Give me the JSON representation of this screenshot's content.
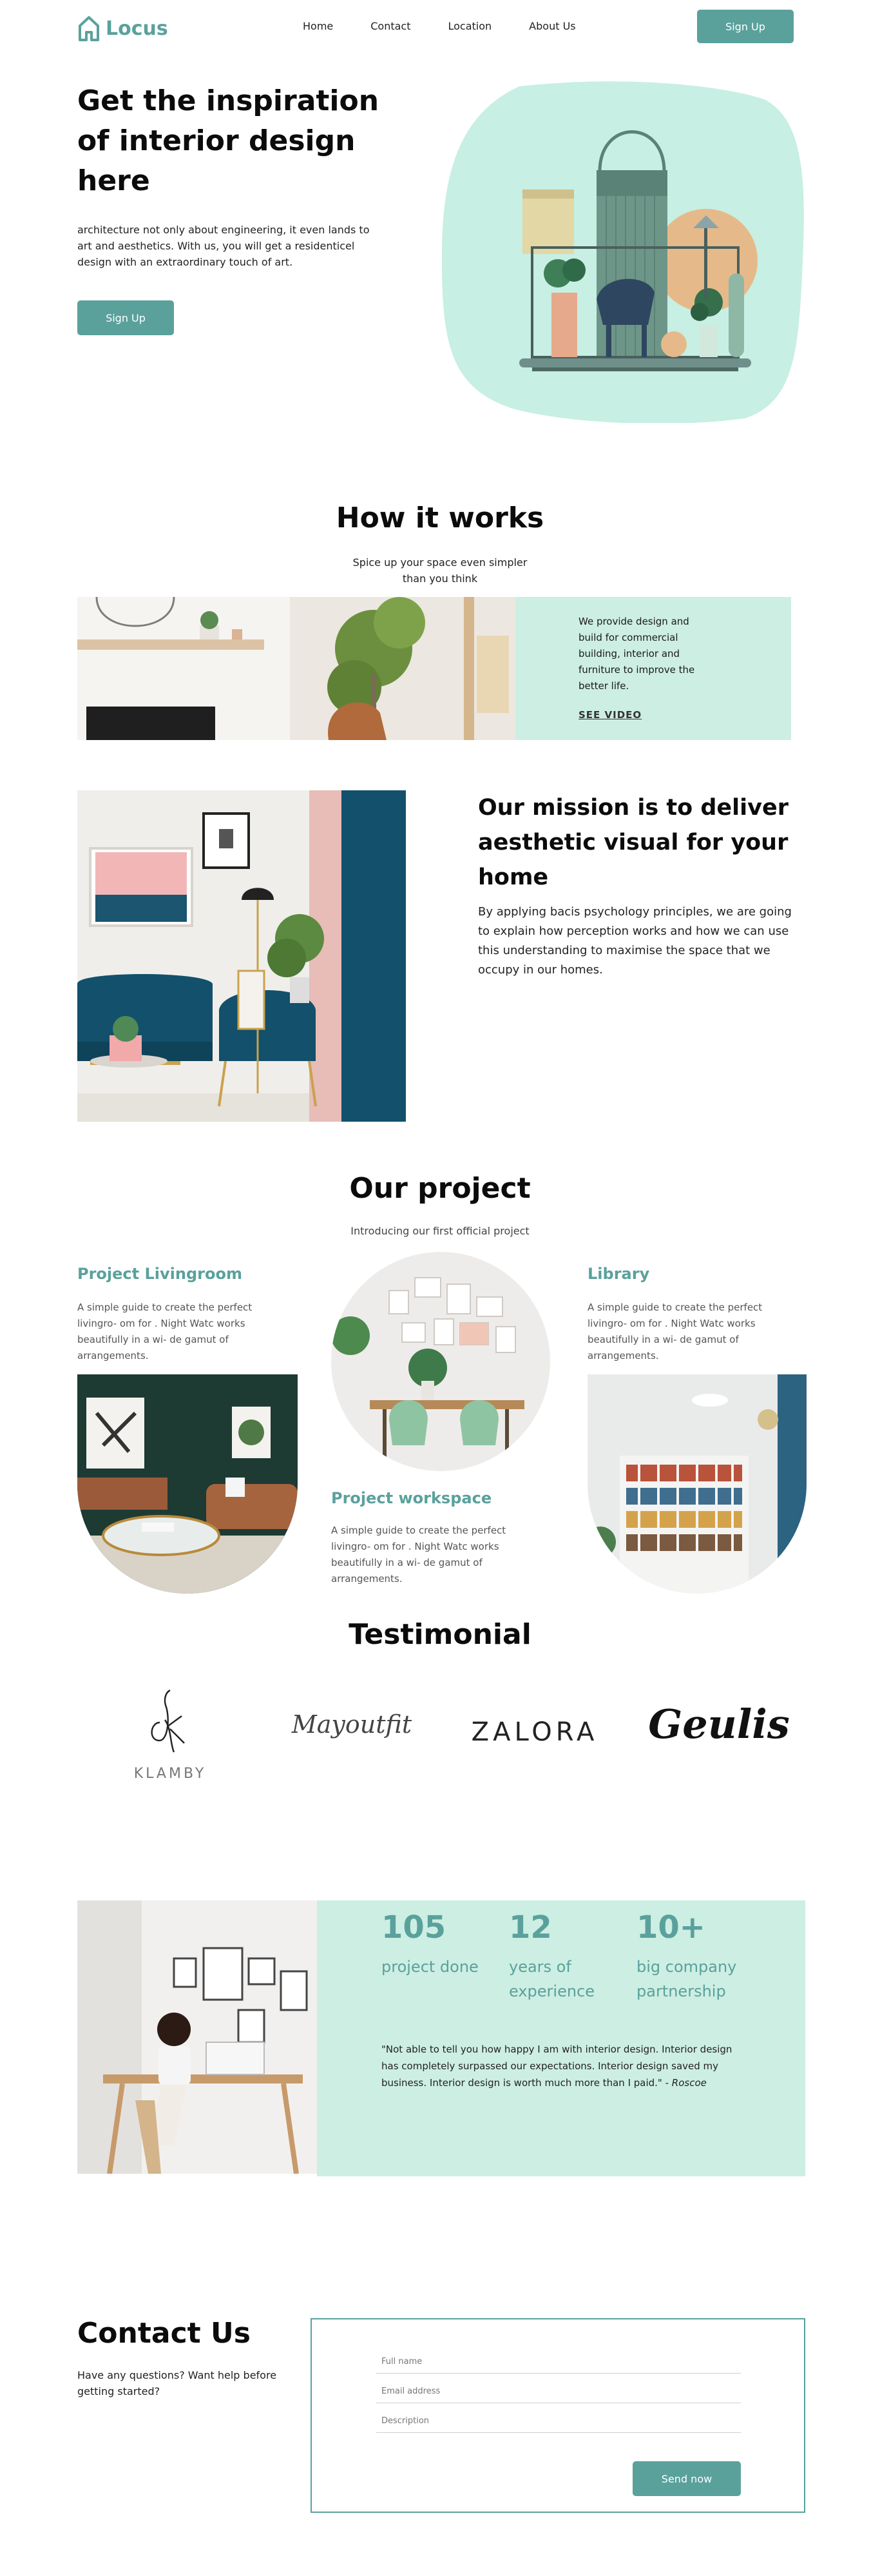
{
  "nav": {
    "logo": "Locus",
    "links": [
      "Home",
      "Contact",
      "Location",
      "About Us"
    ],
    "signup": "Sign Up"
  },
  "hero": {
    "title": "Get the inspiration of interior design here",
    "description": "architecture not only about engineering, it even lands to art and aesthetics. With us, you will get a residenticel design with an extraordinary touch of art.",
    "button": "Sign Up"
  },
  "how": {
    "title": "How it works",
    "subtitle": "Spice up your space even simpler than you think",
    "text": "We provide design and build for commercial building, interior and furniture to improve the better life.",
    "video": "SEE VIDEO"
  },
  "mission": {
    "title": "Our mission is to deliver aesthetic visual for your home",
    "description": "By applying bacis psychology principles, we are going to explain how perception works and how we can use this understanding to maximise the space that we occupy in our homes."
  },
  "projects": {
    "title": "Our project",
    "subtitle": "Introducing our first official project",
    "items": [
      {
        "title": "Project Livingroom",
        "description": "A simple guide to create the perfect livingro- om for . Night Watc works beautifully in a wi- de gamut of arrangements."
      },
      {
        "title": "Project workspace",
        "description": "A simple guide to create the perfect livingro- om for . Night Watc works beautifully in a wi- de gamut of arrangements."
      },
      {
        "title": "Library",
        "description": "A simple guide to create the perfect livingro- om for . Night Watc works beautifully in a wi- de gamut of arrangements."
      }
    ]
  },
  "testimonial": {
    "title": "Testimonial",
    "brands": [
      "KLAMBY",
      "Mayoutfit",
      "ZALORA",
      "Geulis"
    ]
  },
  "stats": {
    "items": [
      {
        "number": "105",
        "label": "project done"
      },
      {
        "number": "12",
        "label": "years of experience"
      },
      {
        "number": "10+",
        "label": "big company partnership"
      }
    ],
    "quote": "\"Not able to tell you how happy I am with interior design. Interior design has completely surpassed our expectations. Interior design saved my business. Interior design is worth much more than I paid.\" -",
    "author": "Roscoe"
  },
  "contact": {
    "title": "Contact Us",
    "description": "Have any questions? Want help before getting started?",
    "name_placeholder": "Full name",
    "email_placeholder": "Email address",
    "desc_placeholder": "Description",
    "button": "Send now"
  },
  "colors": {
    "accent": "#5aa19c",
    "panel": "#cdeee3",
    "blob": "#c7efe3"
  }
}
